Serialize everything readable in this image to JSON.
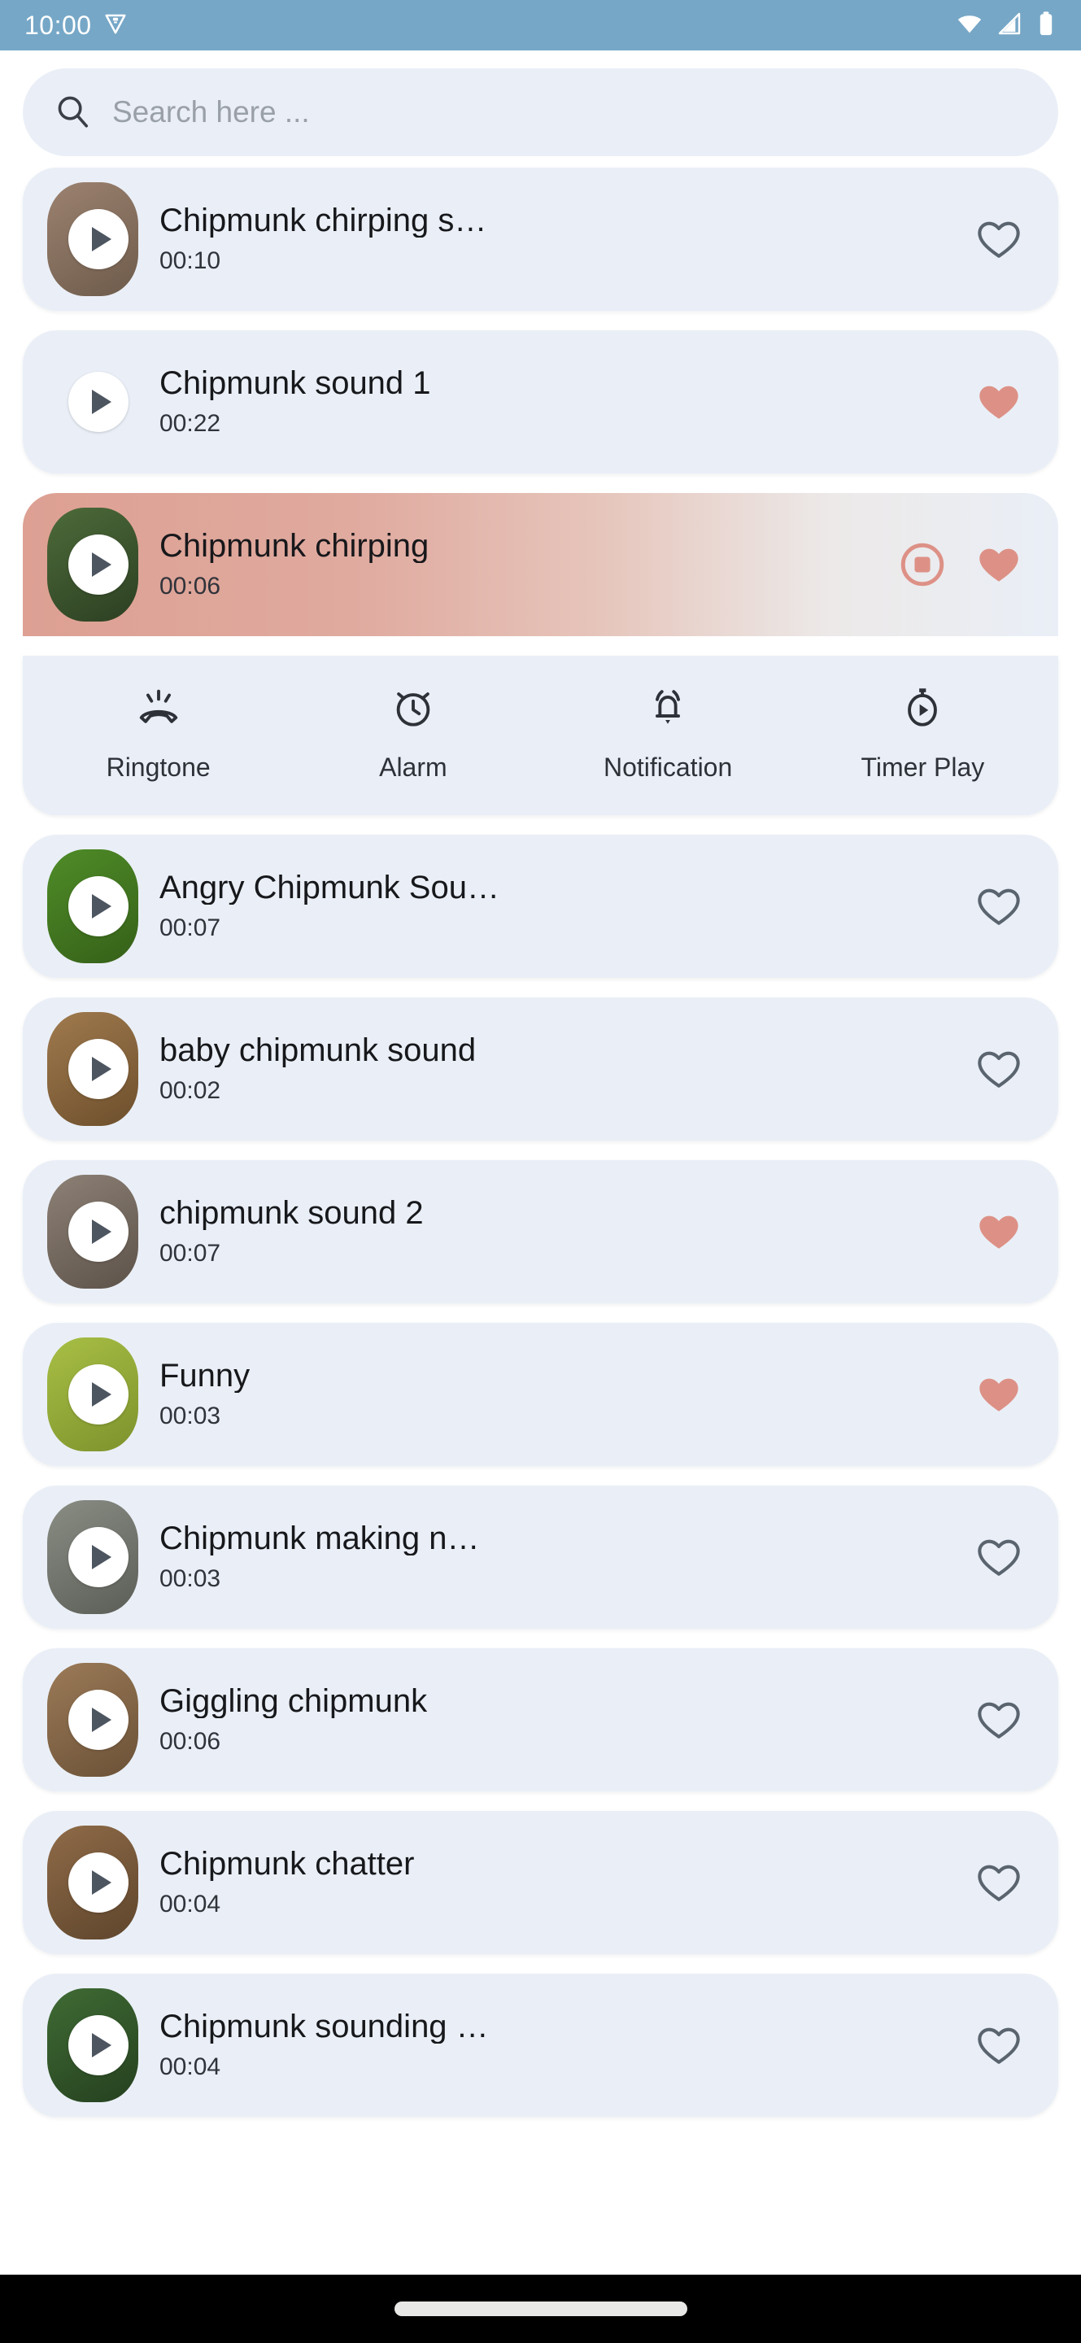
{
  "status_bar": {
    "time": "10:00",
    "icons": [
      "notification-badge-icon",
      "wifi-icon",
      "cellular-signal-icon",
      "battery-icon"
    ],
    "background_color": "#76a7c7"
  },
  "search": {
    "placeholder": "Search here ...",
    "value": "",
    "icon": "search-icon"
  },
  "theme": {
    "card_background": "#eaeff7",
    "page_background": "#ffffff",
    "accent_salmon": "#dd9186",
    "selected_gradient_start": "#dda093",
    "text_primary": "#17181b",
    "text_secondary": "#30333a"
  },
  "sounds": [
    {
      "title": "Chipmunk chirping s…",
      "duration": "00:10",
      "favorite": false,
      "selected": false,
      "thumb_colors": [
        "#9c8270",
        "#6e5b4b"
      ]
    },
    {
      "title": "Chipmunk sound 1",
      "duration": "00:22",
      "favorite": true,
      "selected": false,
      "thumb_colors": [
        "#6d5murky",
        "#4a3a2e"
      ]
    },
    {
      "title": "Chipmunk chirping",
      "duration": "00:06",
      "favorite": true,
      "selected": true,
      "thumb_colors": [
        "#4d6b3a",
        "#2c3f22"
      ]
    },
    {
      "title": "Angry Chipmunk Sou…",
      "duration": "00:07",
      "favorite": false,
      "selected": false,
      "thumb_colors": [
        "#4f8c28",
        "#356018"
      ]
    },
    {
      "title": "baby chipmunk sound",
      "duration": "00:02",
      "favorite": false,
      "selected": false,
      "thumb_colors": [
        "#a07a4e",
        "#6d4f2c"
      ]
    },
    {
      "title": "chipmunk sound 2",
      "duration": "00:07",
      "favorite": true,
      "selected": false,
      "thumb_colors": [
        "#8d8176",
        "#5d5249"
      ]
    },
    {
      "title": "Funny",
      "duration": "00:03",
      "favorite": true,
      "selected": false,
      "thumb_colors": [
        "#a8bf45",
        "#7d922c"
      ]
    },
    {
      "title": "Chipmunk making n…",
      "duration": "00:03",
      "favorite": false,
      "selected": false,
      "thumb_colors": [
        "#8a8d84",
        "#5b5e57"
      ]
    },
    {
      "title": "Giggling chipmunk",
      "duration": "00:06",
      "favorite": false,
      "selected": false,
      "thumb_colors": [
        "#9b7a57",
        "#6b5137"
      ]
    },
    {
      "title": "Chipmunk chatter",
      "duration": "00:04",
      "favorite": false,
      "selected": false,
      "thumb_colors": [
        "#8f6b48",
        "#5e452c"
      ]
    },
    {
      "title": "Chipmunk sounding …",
      "duration": "00:04",
      "favorite": false,
      "selected": false,
      "thumb_colors": [
        "#3f6b34",
        "#25401f"
      ]
    }
  ],
  "action_panel": {
    "items": [
      {
        "label": "Ringtone",
        "icon": "ringtone-icon"
      },
      {
        "label": "Alarm",
        "icon": "alarm-clock-icon"
      },
      {
        "label": "Notification",
        "icon": "notification-bell-icon"
      },
      {
        "label": "Timer Play",
        "icon": "timer-play-icon"
      }
    ]
  },
  "nav_bar": {
    "gesture_pill": "home-gesture-pill"
  }
}
